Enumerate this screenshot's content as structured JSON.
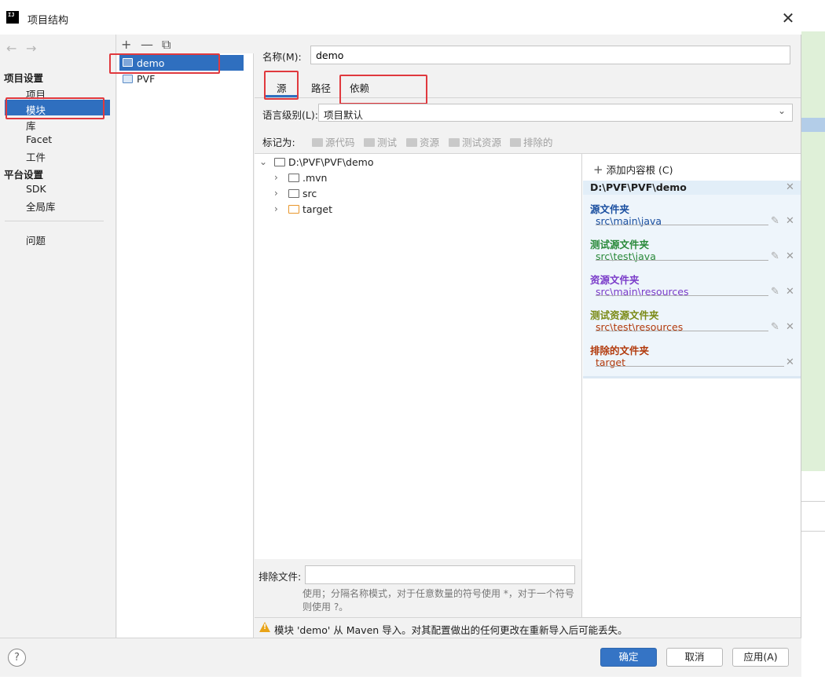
{
  "window": {
    "title": "项目结构",
    "logo_text": "IJ"
  },
  "nav": {
    "project_settings_header": "项目设置",
    "project_items": [
      {
        "label": "项目"
      },
      {
        "label": "模块"
      },
      {
        "label": "库"
      },
      {
        "label": "Facet"
      },
      {
        "label": "工件"
      }
    ],
    "platform_settings_header": "平台设置",
    "platform_items": [
      {
        "label": "SDK"
      },
      {
        "label": "全局库"
      }
    ],
    "problems": "问题",
    "selected": "模块"
  },
  "modules": {
    "toolbar": {
      "add": "+",
      "remove": "—",
      "copy": "⧉"
    },
    "items": [
      {
        "label": "demo"
      },
      {
        "label": "PVF"
      }
    ],
    "selected": "demo"
  },
  "main": {
    "name_label": "名称(M):",
    "name_value": "demo",
    "tabs": [
      {
        "label": "源"
      },
      {
        "label": "路径"
      },
      {
        "label": "依赖"
      }
    ],
    "active_tab": "源",
    "language_level_label": "语言级别(L):",
    "language_level_value": "项目默认",
    "mark_as_label": "标记为:",
    "mark_buttons": [
      {
        "label": "源代码"
      },
      {
        "label": "测试"
      },
      {
        "label": "资源"
      },
      {
        "label": "测试资源"
      },
      {
        "label": "排除的"
      }
    ],
    "tree": {
      "root": "D:\\PVF\\PVF\\demo",
      "children": [
        {
          "label": ".mvn"
        },
        {
          "label": "src"
        },
        {
          "label": "target"
        }
      ]
    },
    "roots_panel": {
      "add_content_root": "添加内容根 (C)",
      "content_root": "D:\\PVF\\PVF\\demo",
      "sections": [
        {
          "title": "源文件夹",
          "path": "src\\main\\java",
          "color": "#1a4fa0"
        },
        {
          "title": "测试源文件夹",
          "path": "src\\test\\java",
          "color": "#2a8a3a"
        },
        {
          "title": "资源文件夹",
          "path": "src\\main\\resources",
          "color": "#7a3bc9"
        },
        {
          "title": "测试资源文件夹",
          "path": "src\\test\\resources",
          "color": "#7a8a15"
        },
        {
          "title": "排除的文件夹",
          "path": "target",
          "color": "#b23a0c"
        }
      ]
    },
    "exclude_label": "排除文件:",
    "exclude_value": "",
    "exclude_hint": "使用；分隔名称模式，对于任意数量的符号使用 *，对于一个符号则使用 ?。",
    "warning": "模块 'demo' 从 Maven 导入。对其配置做出的任何更改在重新导入后可能丢失。"
  },
  "buttons": {
    "help": "?",
    "ok": "确定",
    "cancel": "取消",
    "apply": "应用(A)"
  },
  "colors": {
    "accent": "#2f6fbf",
    "highlight": "#e0393e",
    "warning": "#e8a317"
  }
}
